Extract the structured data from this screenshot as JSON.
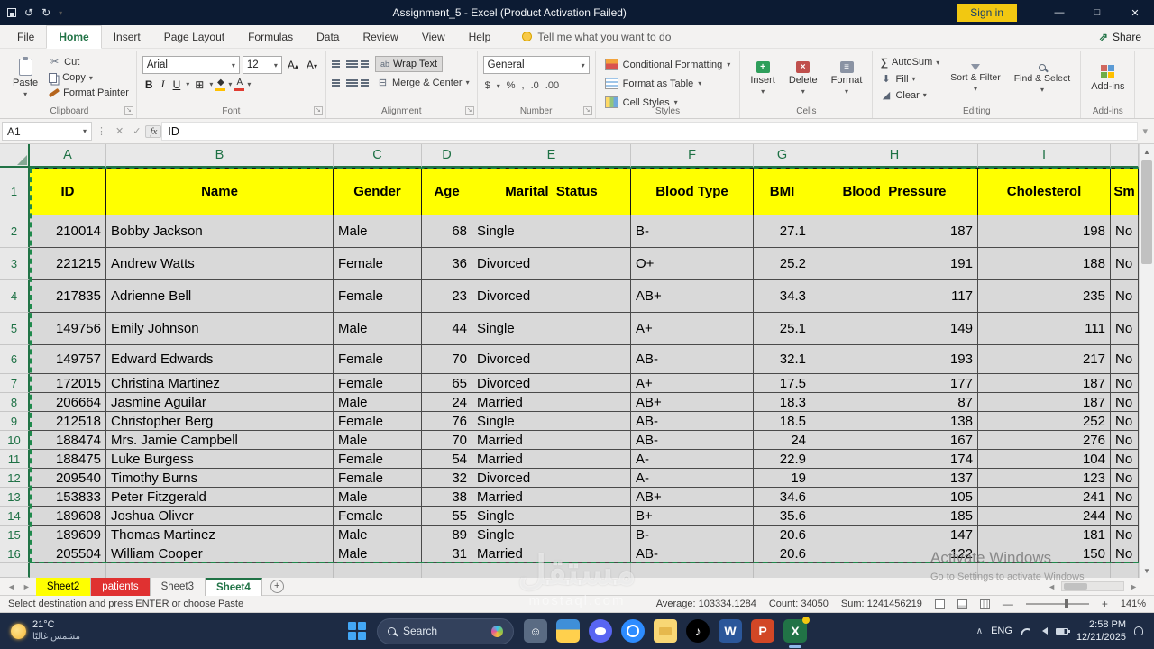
{
  "title_bar": {
    "title": "Assignment_5  -  Excel (Product Activation Failed)",
    "sign_in": "Sign in"
  },
  "menu": {
    "tabs": [
      "File",
      "Home",
      "Insert",
      "Page Layout",
      "Formulas",
      "Data",
      "Review",
      "View",
      "Help"
    ],
    "tell_me": "Tell me what you want to do",
    "share": "Share"
  },
  "ribbon": {
    "clipboard": {
      "label": "Clipboard",
      "paste": "Paste",
      "cut": "Cut",
      "copy": "Copy",
      "format_painter": "Format Painter"
    },
    "font": {
      "label": "Font",
      "name": "Arial",
      "size": "12",
      "bold": "B",
      "italic": "I",
      "underline": "U"
    },
    "alignment": {
      "label": "Alignment",
      "wrap": "Wrap Text",
      "merge": "Merge & Center"
    },
    "number": {
      "label": "Number",
      "format": "General",
      "currency": "$",
      "percent": "%",
      "comma": ",",
      "dec1": ".0",
      "dec2": ".00"
    },
    "styles": {
      "label": "Styles",
      "conditional": "Conditional Formatting",
      "table": "Format as Table",
      "cell": "Cell Styles"
    },
    "cells": {
      "label": "Cells",
      "insert": "Insert",
      "delete": "Delete",
      "format": "Format"
    },
    "editing": {
      "label": "Editing",
      "autosum": "AutoSum",
      "fill": "Fill",
      "clear": "Clear",
      "sort": "Sort & Filter",
      "find": "Find & Select"
    },
    "addins": {
      "label": "Add-ins",
      "button": "Add-ins"
    }
  },
  "formula_bar": {
    "name_box": "A1",
    "fx": "fx",
    "value": "ID"
  },
  "sheet": {
    "col_letters": [
      "A",
      "B",
      "C",
      "D",
      "E",
      "F",
      "G",
      "H",
      "I"
    ],
    "headers": [
      "ID",
      "Name",
      "Gender",
      "Age",
      "Marital_Status",
      "Blood Type",
      "BMI",
      "Blood_Pressure",
      "Cholesterol",
      "Sm"
    ],
    "rows": [
      [
        "210014",
        "Bobby Jackson",
        "Male",
        "68",
        "Single",
        "B-",
        "27.1",
        "187",
        "198",
        "No"
      ],
      [
        "221215",
        "Andrew Watts",
        "Female",
        "36",
        "Divorced",
        "O+",
        "25.2",
        "191",
        "188",
        "No"
      ],
      [
        "217835",
        "Adrienne Bell",
        "Female",
        "23",
        "Divorced",
        "AB+",
        "34.3",
        "117",
        "235",
        "No"
      ],
      [
        "149756",
        "Emily Johnson",
        "Male",
        "44",
        "Single",
        "A+",
        "25.1",
        "149",
        "111",
        "No"
      ],
      [
        "149757",
        "Edward Edwards",
        "Female",
        "70",
        "Divorced",
        "AB-",
        "32.1",
        "193",
        "217",
        "No"
      ],
      [
        "172015",
        "Christina Martinez",
        "Female",
        "65",
        "Divorced",
        "A+",
        "17.5",
        "177",
        "187",
        "No"
      ],
      [
        "206664",
        "Jasmine Aguilar",
        "Male",
        "24",
        "Married",
        "AB+",
        "18.3",
        "87",
        "187",
        "No"
      ],
      [
        "212518",
        "Christopher Berg",
        "Female",
        "76",
        "Single",
        "AB-",
        "18.5",
        "138",
        "252",
        "No"
      ],
      [
        "188474",
        "Mrs. Jamie Campbell",
        "Male",
        "70",
        "Married",
        "AB-",
        "24",
        "167",
        "276",
        "No"
      ],
      [
        "188475",
        "Luke Burgess",
        "Female",
        "54",
        "Married",
        "A-",
        "22.9",
        "174",
        "104",
        "No"
      ],
      [
        "209540",
        "Timothy Burns",
        "Female",
        "32",
        "Divorced",
        "A-",
        "19",
        "137",
        "123",
        "No"
      ],
      [
        "153833",
        "Peter Fitzgerald",
        "Male",
        "38",
        "Married",
        "AB+",
        "34.6",
        "105",
        "241",
        "No"
      ],
      [
        "189608",
        "Joshua Oliver",
        "Female",
        "55",
        "Single",
        "B+",
        "35.6",
        "185",
        "244",
        "No"
      ],
      [
        "189609",
        "Thomas Martinez",
        "Male",
        "89",
        "Single",
        "B-",
        "20.6",
        "147",
        "181",
        "No"
      ],
      [
        "205504",
        "William Cooper",
        "Male",
        "31",
        "Married",
        "AB-",
        "20.6",
        "122",
        "150",
        "No"
      ]
    ]
  },
  "tabs": {
    "items": [
      {
        "label": "Sheet2",
        "style": "yellow"
      },
      {
        "label": "patients",
        "style": "red"
      },
      {
        "label": "Sheet3",
        "style": "plain"
      },
      {
        "label": "Sheet4",
        "style": "active"
      }
    ]
  },
  "status_bar": {
    "message": "Select destination and press ENTER or choose Paste",
    "average": "Average: 103334.1284",
    "count": "Count: 34050",
    "sum": "Sum: 1241456219",
    "zoom": "141%"
  },
  "taskbar": {
    "temperature": "21°C",
    "weather": "مشمس غالبًا",
    "search": "Search",
    "language": "ENG",
    "time": "2:58 PM",
    "date": "12/21/2025",
    "icons": [
      "people",
      "file-explorer",
      "discord",
      "camera",
      "folder",
      "tiktok",
      "word",
      "powerpoint",
      "excel"
    ]
  },
  "watermarks": {
    "activate_title": "Activate Windows",
    "activate_sub": "Go to Settings to activate Windows",
    "brand": "مستقل",
    "brand_domain": "mostaql.com"
  },
  "colors": {
    "accent_green": "#217346",
    "header_fill": "#ffff00",
    "tab_red": "#e03131",
    "signin_yellow": "#f2c811"
  }
}
